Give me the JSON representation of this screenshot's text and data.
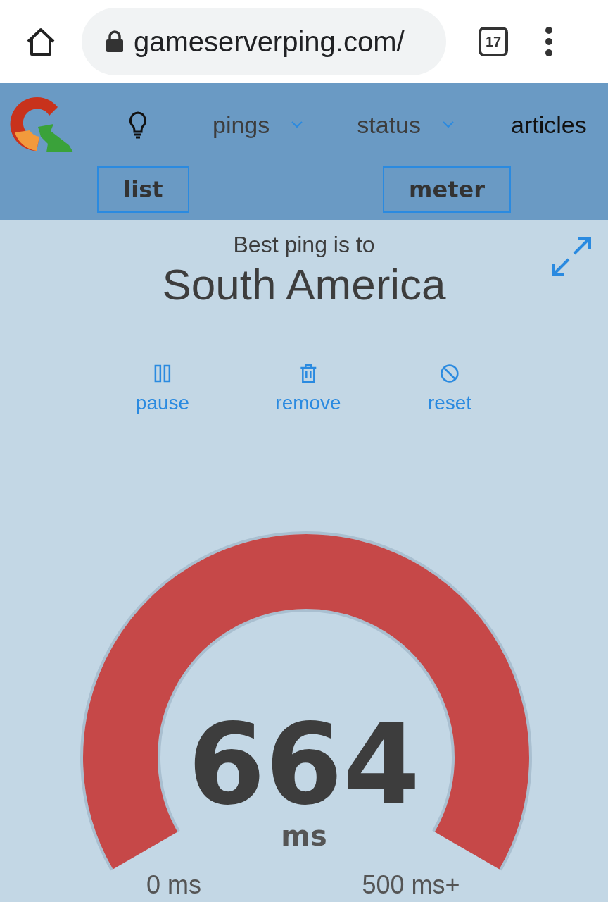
{
  "browser": {
    "url": "gameserverping.com/",
    "tab_count": "17"
  },
  "nav": {
    "items": [
      {
        "label": "pings",
        "kind": "dropdown"
      },
      {
        "label": "status",
        "kind": "dropdown"
      },
      {
        "label": "articles",
        "kind": "link"
      }
    ],
    "views": [
      {
        "label": "list"
      },
      {
        "label": "meter"
      }
    ]
  },
  "best": {
    "caption": "Best ping is to",
    "region": "South America"
  },
  "actions": [
    {
      "label": "pause",
      "kind": "pause"
    },
    {
      "label": "remove",
      "kind": "remove"
    },
    {
      "label": "reset",
      "kind": "reset"
    }
  ],
  "meter": {
    "value": "664",
    "unit": "ms",
    "min_label": "0 ms",
    "max_label": "500 ms+"
  }
}
